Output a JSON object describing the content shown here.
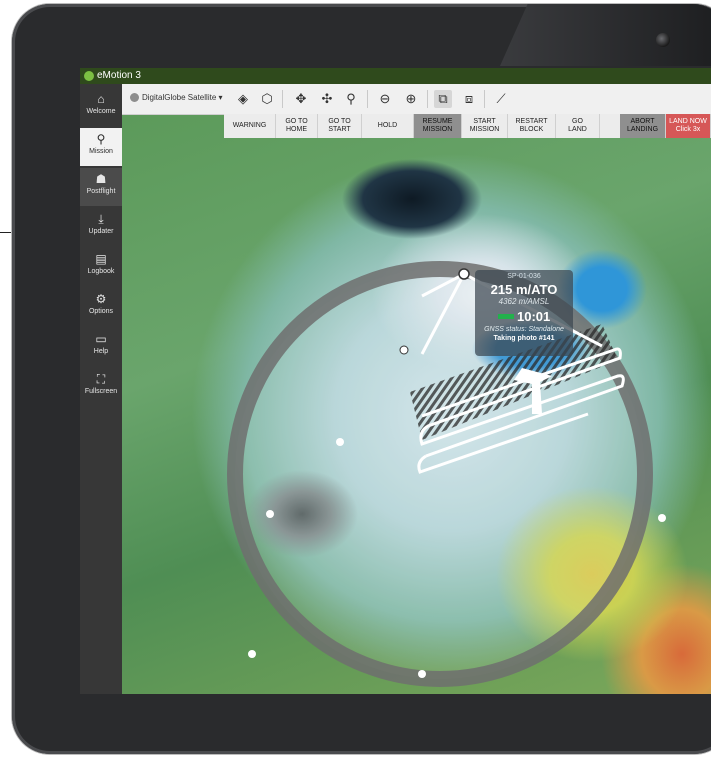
{
  "app": {
    "title": "eMotion 3"
  },
  "sidebar": {
    "items": [
      {
        "label": "Welcome",
        "icon": "home-icon",
        "glyph": "⌂"
      },
      {
        "label": "Mission",
        "icon": "route-pin-icon",
        "glyph": "⚲"
      },
      {
        "label": "Postflight",
        "icon": "postflight-icon",
        "glyph": "☗"
      },
      {
        "label": "Updater",
        "icon": "download-icon",
        "glyph": "⤓"
      },
      {
        "label": "Logbook",
        "icon": "logbook-icon",
        "glyph": "▤"
      },
      {
        "label": "Options",
        "icon": "gear-icon",
        "glyph": "⚙"
      },
      {
        "label": "Help",
        "icon": "book-icon",
        "glyph": "▭"
      },
      {
        "label": "Fullscreen",
        "icon": "fullscreen-icon",
        "glyph": "⛶"
      }
    ]
  },
  "toolbar": {
    "basemap": "DigitalGlobe Satellite",
    "basemap_arrow": "▾",
    "icons": [
      {
        "name": "layers-icon",
        "glyph": "◈"
      },
      {
        "name": "cube-icon",
        "glyph": "⬡"
      },
      {
        "name": "move-drone-icon",
        "glyph": "✥"
      },
      {
        "name": "move-home-icon",
        "glyph": "✣"
      },
      {
        "name": "map-pin-icon",
        "glyph": "⚲"
      },
      {
        "name": "zoom-out-icon",
        "glyph": "⊖"
      },
      {
        "name": "zoom-in-icon",
        "glyph": "⊕"
      },
      {
        "name": "flight-lines-icon",
        "glyph": "⧉"
      },
      {
        "name": "flight-lines-alt-icon",
        "glyph": "⧈"
      },
      {
        "name": "ruler-icon",
        "glyph": "⟋"
      }
    ]
  },
  "commands": [
    {
      "label": "WARNING",
      "style": "light"
    },
    {
      "label": "GO TO\nHOME",
      "style": "light"
    },
    {
      "label": "GO TO\nSTART",
      "style": "light"
    },
    {
      "label": "HOLD",
      "style": "light"
    },
    {
      "label": "RESUME\nMISSION",
      "style": "dark"
    },
    {
      "label": "START\nMISSION",
      "style": "light"
    },
    {
      "label": "RESTART\nBLOCK",
      "style": "light"
    },
    {
      "label": "GO\nLAND",
      "style": "light"
    },
    {
      "label": "ABORT\nLANDING",
      "style": "dark"
    },
    {
      "label": "LAND NOW\nClick 3x",
      "style": "red"
    }
  ],
  "drone_label": {
    "id": "SP-01-036",
    "altitude_ato": "215 m/ATO",
    "altitude_amsl": "4362 m/AMSL",
    "flight_time": "10:01",
    "gnss_status": "GNSS status: Standalone",
    "photo_status": "Taking photo #141"
  },
  "colors": {
    "title_bar": "#2f4a1c",
    "sidebar": "#373737",
    "command_dark": "#8f8f8f",
    "land_now": "#d65757",
    "battery": "#22b14c",
    "flight_lines": "#ffffff",
    "photo_hatch": "#2a2a2a",
    "range_ring": "#6e6e6e"
  }
}
